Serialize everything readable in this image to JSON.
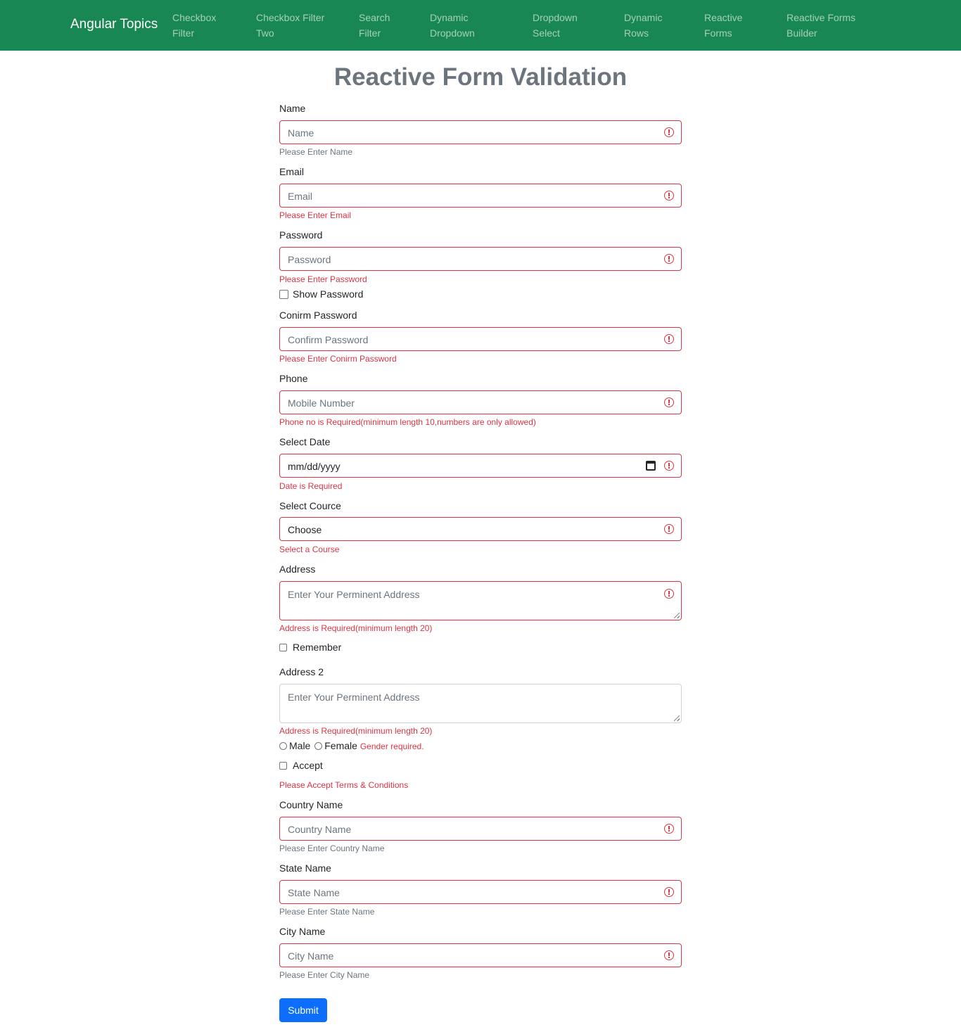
{
  "navbar": {
    "brand": "Angular Topics",
    "items": [
      {
        "line1": "Checkbox",
        "line2": "Filter"
      },
      {
        "line1": "Checkbox Filter",
        "line2": "Two"
      },
      {
        "line1": "Search",
        "line2": "Filter"
      },
      {
        "line1": "Dynamic",
        "line2": "Dropdown"
      },
      {
        "line1": "Dropdown",
        "line2": "Select"
      },
      {
        "line1": "Dynamic",
        "line2": "Rows"
      },
      {
        "line1": "Reactive",
        "line2": "Forms"
      },
      {
        "line1": "Reactive Forms",
        "line2": "Builder"
      }
    ],
    "bg_color": "#198754"
  },
  "page_title": "Reactive Form Validation",
  "form": {
    "name": {
      "label": "Name",
      "placeholder": "Name",
      "help": "Please Enter Name"
    },
    "email": {
      "label": "Email",
      "placeholder": "Email",
      "error": "Please Enter Email"
    },
    "password": {
      "label": "Password",
      "placeholder": "Password",
      "error": "Please Enter Password"
    },
    "show_password": {
      "label": "Show Password",
      "checked": false
    },
    "confirm_password": {
      "label": "Conirm Password",
      "placeholder": "Confirm Password",
      "error": "Please Enter Conirm Password"
    },
    "phone": {
      "label": "Phone",
      "placeholder": "Mobile Number",
      "error": "Phone no is Required(minimum length 10,numbers are only allowed)"
    },
    "date": {
      "label": "Select Date",
      "value": "mm/dd/yyyy",
      "error": "Date is Required"
    },
    "course": {
      "label": "Select Cource",
      "value": "Choose",
      "error": "Select a Course"
    },
    "address": {
      "label": "Address",
      "placeholder": "Enter Your Perminent Address",
      "error": "Address is Required(minimum length 20)"
    },
    "remember": {
      "label": "Remember",
      "checked": false
    },
    "address2": {
      "label": "Address 2",
      "placeholder": "Enter Your Perminent Address",
      "error": "Address is Required(minimum length 20)"
    },
    "gender": {
      "options": [
        "Male",
        "Female"
      ],
      "error": "Gender required."
    },
    "accept": {
      "label": "Accept",
      "checked": false,
      "error": "Please Accept Terms & Conditions"
    },
    "country": {
      "label": "Country Name",
      "placeholder": "Country Name",
      "help": "Please Enter Country Name"
    },
    "state": {
      "label": "State Name",
      "placeholder": "State Name",
      "help": "Please Enter State Name"
    },
    "city": {
      "label": "City Name",
      "placeholder": "City Name",
      "help": "Please Enter City Name"
    },
    "submit_label": "Submit"
  },
  "colors": {
    "error": "#dc3545",
    "primary": "#0d6efd",
    "muted": "#6c757d"
  }
}
